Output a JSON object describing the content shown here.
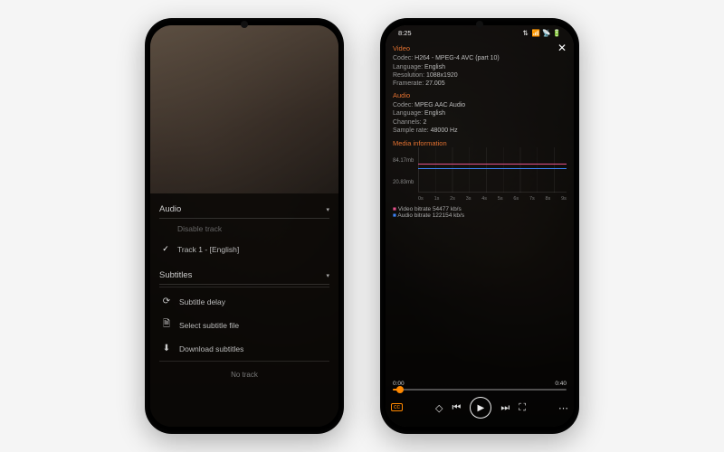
{
  "left": {
    "audio": {
      "header": "Audio",
      "disable": "Disable track",
      "track1": "Track 1 - [English]"
    },
    "subtitles": {
      "header": "Subtitles",
      "delay": "Subtitle delay",
      "select": "Select subtitle file",
      "download": "Download subtitles",
      "notrack": "No track"
    }
  },
  "right": {
    "status": {
      "time": "8:25",
      "net": "⇅",
      "icons": "📶 📡 🔋"
    },
    "video": {
      "title": "Video",
      "codec_k": "Codec:",
      "codec_v": "H264 - MPEG-4 AVC (part 10)",
      "lang_k": "Language:",
      "lang_v": "English",
      "res_k": "Resolution:",
      "res_v": "1088x1920",
      "fr_k": "Framerate:",
      "fr_v": "27.005"
    },
    "audio": {
      "title": "Audio",
      "codec_k": "Codec:",
      "codec_v": "MPEG AAC Audio",
      "lang_k": "Language:",
      "lang_v": "English",
      "ch_k": "Channels:",
      "ch_v": "2",
      "sr_k": "Sample rate:",
      "sr_v": "48000 Hz"
    },
    "bitrate": {
      "video_label": "Video bitrate",
      "video_val": "54477 kb/s",
      "audio_label": "Audio bitrate",
      "audio_val": "122154 kb/s"
    },
    "seek": {
      "cur": "0:00",
      "dur": "0:40"
    }
  },
  "chart_data": {
    "type": "line",
    "title": "Media information",
    "xlabel": "",
    "ylabel": "",
    "categories": [
      "0s",
      "1s",
      "2s",
      "3s",
      "4s",
      "5s",
      "6s",
      "7s",
      "8s",
      "9s"
    ],
    "series": [
      {
        "name": "video",
        "color": "#e5528b",
        "values": [
          54477,
          54477,
          54477,
          54477,
          54477,
          54477,
          54477,
          54477,
          54477,
          54477
        ]
      },
      {
        "name": "audio",
        "color": "#3b82f6",
        "values": [
          122154,
          122154,
          122154,
          122154,
          122154,
          122154,
          122154,
          122154,
          122154,
          122154
        ]
      }
    ],
    "y_ticks": [
      "84.17mb",
      "20.83mb"
    ],
    "ylim": [
      0,
      90000
    ]
  }
}
